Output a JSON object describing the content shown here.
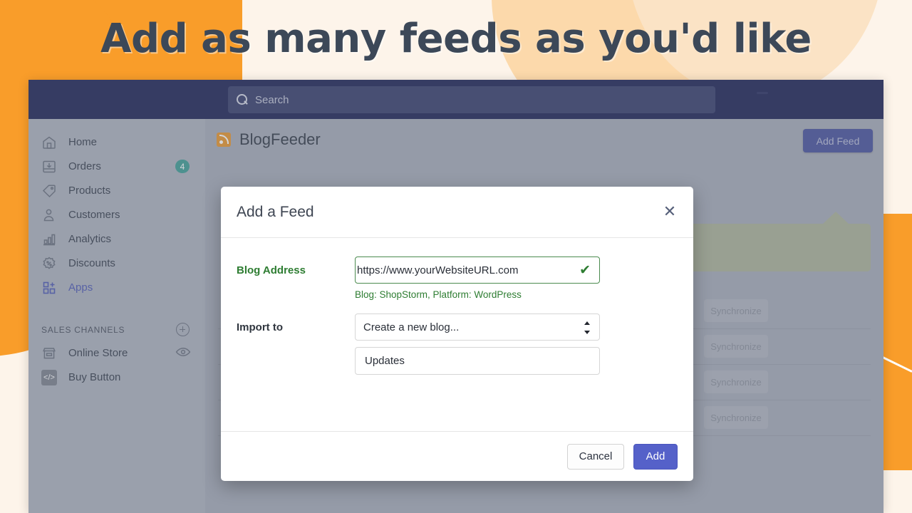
{
  "headline": "Add as many feeds as you'd like",
  "topbar": {
    "search_placeholder": "Search",
    "search_icon": "search-icon"
  },
  "sidebar": {
    "items": [
      {
        "label": "Home",
        "icon": "home-icon",
        "badge": ""
      },
      {
        "label": "Orders",
        "icon": "orders-inbox-icon",
        "badge": "4"
      },
      {
        "label": "Products",
        "icon": "tag-icon",
        "badge": ""
      },
      {
        "label": "Customers",
        "icon": "person-icon",
        "badge": ""
      },
      {
        "label": "Analytics",
        "icon": "bar-chart-icon",
        "badge": ""
      },
      {
        "label": "Discounts",
        "icon": "discount-percent-icon",
        "badge": ""
      },
      {
        "label": "Apps",
        "icon": "apps-grid-plus-icon",
        "badge": ""
      }
    ],
    "section_title": "SALES CHANNELS",
    "section_add_icon": "plus-circle-icon",
    "channels": [
      {
        "label": "Online Store",
        "icon": "storefront-icon",
        "trailing_icon": "eye-icon"
      },
      {
        "label": "Buy Button",
        "icon": "code-icon",
        "trailing_icon": ""
      }
    ]
  },
  "page": {
    "app_icon": "rss-icon",
    "title": "BlogFeeder",
    "add_feed_label": "Add Feed",
    "sync_label": "Synchronize",
    "row_count": 4
  },
  "modal": {
    "title": "Add a Feed",
    "close_icon": "close-icon",
    "blog_address_label": "Blog Address",
    "blog_address_value": "https://www.yourWebsiteURL.com",
    "blog_address_valid_icon": "checkmark-icon",
    "helper_text": "Blog: ShopStorm, Platform: WordPress",
    "import_to_label": "Import to",
    "import_to_selected": "Create a new blog...",
    "blog_name_value": "Updates",
    "cancel_label": "Cancel",
    "add_label": "Add"
  },
  "colors": {
    "brand_orange": "#f99d2a",
    "topbar_navy": "#1f2457",
    "accent_indigo": "#5561c9",
    "valid_green": "#2e7d32",
    "badge_teal": "#3f9e96"
  }
}
